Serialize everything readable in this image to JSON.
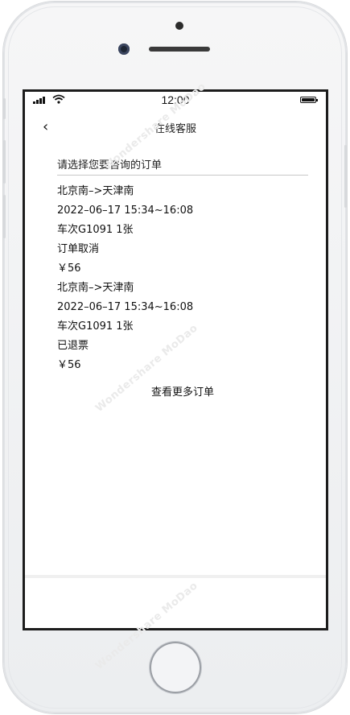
{
  "status": {
    "time": "12:00"
  },
  "nav": {
    "title": "在线客服",
    "back_icon": "chevron-left-icon"
  },
  "prompt": "请选择您要咨询的订单",
  "orders": [
    {
      "route": "北京南–>天津南",
      "datetime": "2022–06–17 15:34~16:08",
      "train": "车次G1091 1张",
      "status": "订单取消",
      "price": "￥56"
    },
    {
      "route": "北京南–>天津南",
      "datetime": "2022–06–17 15:34~16:08",
      "train": "车次G1091 1张",
      "status": "已退票",
      "price": "￥56"
    }
  ],
  "more_label": "查看更多订单",
  "watermark": "Wondershare MoDao"
}
